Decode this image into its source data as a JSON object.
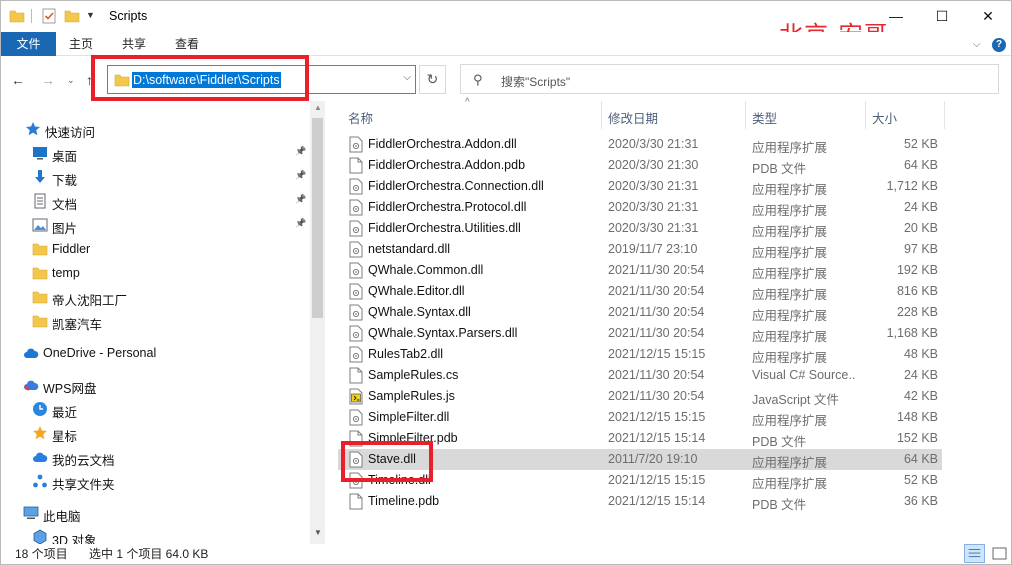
{
  "window": {
    "title": "Scripts",
    "watermark": "北京-宏哥",
    "controls": {
      "minimize": "—",
      "maximize": "☐",
      "close": "✕"
    }
  },
  "ribbon": {
    "tabs": [
      "文件",
      "主页",
      "共享",
      "查看"
    ]
  },
  "navigation": {
    "address": "D:\\software\\Fiddler\\Scripts",
    "search_placeholder": "搜索\"Scripts\""
  },
  "sidebar": {
    "items": [
      {
        "label": "快速访问",
        "icon": "star-icon",
        "pinned": false
      },
      {
        "label": "桌面",
        "icon": "desktop-icon",
        "pinned": true
      },
      {
        "label": "下载",
        "icon": "download-icon",
        "pinned": true
      },
      {
        "label": "文档",
        "icon": "documents-icon",
        "pinned": true
      },
      {
        "label": "图片",
        "icon": "pictures-icon",
        "pinned": true
      },
      {
        "label": "Fiddler",
        "icon": "folder-icon",
        "pinned": false
      },
      {
        "label": "temp",
        "icon": "folder-icon",
        "pinned": false
      },
      {
        "label": "帝人沈阳工厂",
        "icon": "folder-icon",
        "pinned": false
      },
      {
        "label": "凯塞汽车",
        "icon": "folder-icon",
        "pinned": false
      },
      {
        "label": "OneDrive - Personal",
        "icon": "cloud-icon",
        "pinned": false
      },
      {
        "label": "WPS网盘",
        "icon": "wps-cloud-icon",
        "pinned": false
      },
      {
        "label": "最近",
        "icon": "clock-icon",
        "pinned": false
      },
      {
        "label": "星标",
        "icon": "star-filled-icon",
        "pinned": false
      },
      {
        "label": "我的云文档",
        "icon": "cloud-doc-icon",
        "pinned": false
      },
      {
        "label": "共享文件夹",
        "icon": "share-folder-icon",
        "pinned": false
      },
      {
        "label": "此电脑",
        "icon": "computer-icon",
        "pinned": false
      },
      {
        "label": "3D 对象",
        "icon": "3d-objects-icon",
        "pinned": false
      }
    ]
  },
  "columns": {
    "name": "名称",
    "date": "修改日期",
    "type": "类型",
    "size": "大小"
  },
  "files": [
    {
      "name": "FiddlerOrchestra.Addon.dll",
      "date": "2020/3/30 21:31",
      "type": "应用程序扩展",
      "size": "52 KB",
      "icon": "dll-icon"
    },
    {
      "name": "FiddlerOrchestra.Addon.pdb",
      "date": "2020/3/30 21:30",
      "type": "PDB 文件",
      "size": "64 KB",
      "icon": "file-icon"
    },
    {
      "name": "FiddlerOrchestra.Connection.dll",
      "date": "2020/3/30 21:31",
      "type": "应用程序扩展",
      "size": "1,712 KB",
      "icon": "dll-icon"
    },
    {
      "name": "FiddlerOrchestra.Protocol.dll",
      "date": "2020/3/30 21:31",
      "type": "应用程序扩展",
      "size": "24 KB",
      "icon": "dll-icon"
    },
    {
      "name": "FiddlerOrchestra.Utilities.dll",
      "date": "2020/3/30 21:31",
      "type": "应用程序扩展",
      "size": "20 KB",
      "icon": "dll-icon"
    },
    {
      "name": "netstandard.dll",
      "date": "2019/11/7 23:10",
      "type": "应用程序扩展",
      "size": "97 KB",
      "icon": "dll-icon"
    },
    {
      "name": "QWhale.Common.dll",
      "date": "2021/11/30 20:54",
      "type": "应用程序扩展",
      "size": "192 KB",
      "icon": "dll-icon"
    },
    {
      "name": "QWhale.Editor.dll",
      "date": "2021/11/30 20:54",
      "type": "应用程序扩展",
      "size": "816 KB",
      "icon": "dll-icon"
    },
    {
      "name": "QWhale.Syntax.dll",
      "date": "2021/11/30 20:54",
      "type": "应用程序扩展",
      "size": "228 KB",
      "icon": "dll-icon"
    },
    {
      "name": "QWhale.Syntax.Parsers.dll",
      "date": "2021/11/30 20:54",
      "type": "应用程序扩展",
      "size": "1,168 KB",
      "icon": "dll-icon"
    },
    {
      "name": "RulesTab2.dll",
      "date": "2021/12/15 15:15",
      "type": "应用程序扩展",
      "size": "48 KB",
      "icon": "dll-icon"
    },
    {
      "name": "SampleRules.cs",
      "date": "2021/11/30 20:54",
      "type": "Visual C# Source...",
      "size": "24 KB",
      "icon": "file-icon"
    },
    {
      "name": "SampleRules.js",
      "date": "2021/11/30 20:54",
      "type": "JavaScript 文件",
      "size": "42 KB",
      "icon": "js-icon"
    },
    {
      "name": "SimpleFilter.dll",
      "date": "2021/12/15 15:15",
      "type": "应用程序扩展",
      "size": "148 KB",
      "icon": "dll-icon"
    },
    {
      "name": "SimpleFilter.pdb",
      "date": "2021/12/15 15:14",
      "type": "PDB 文件",
      "size": "152 KB",
      "icon": "file-icon"
    },
    {
      "name": "Stave.dll",
      "date": "2011/7/20 19:10",
      "type": "应用程序扩展",
      "size": "64 KB",
      "icon": "dll-icon",
      "selected": true
    },
    {
      "name": "Timeline.dll",
      "date": "2021/12/15 15:15",
      "type": "应用程序扩展",
      "size": "52 KB",
      "icon": "dll-icon"
    },
    {
      "name": "Timeline.pdb",
      "date": "2021/12/15 15:14",
      "type": "PDB 文件",
      "size": "36 KB",
      "icon": "file-icon"
    }
  ],
  "status": {
    "count": "18 个项目",
    "selection": "选中 1 个项目  64.0 KB"
  },
  "colors": {
    "accent": "#1a67b3",
    "selection": "#0078d7",
    "highlight": "#ea1f2a",
    "brand": "#e8262e"
  }
}
